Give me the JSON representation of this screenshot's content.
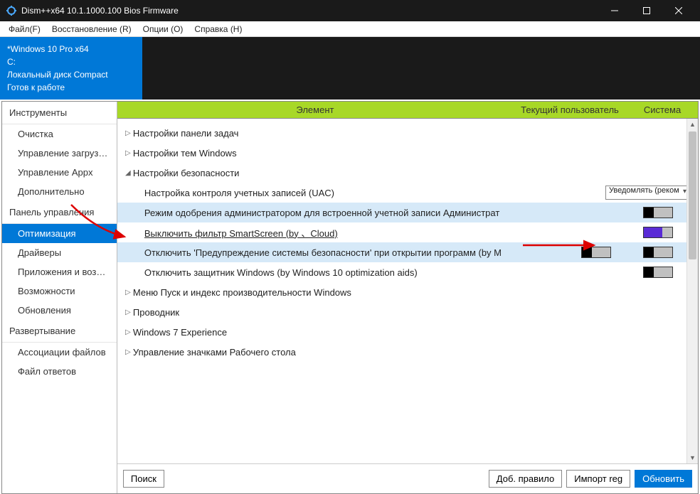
{
  "title": "Dism++x64 10.1.1000.100 Bios Firmware",
  "menu": [
    "Файл(F)",
    "Восстановление (R)",
    "Опции (O)",
    "Справка (H)"
  ],
  "info": {
    "os": "*Windows 10 Pro x64",
    "drive": "C:",
    "disk": "Локальный диск Compact",
    "status": "Готов к работе"
  },
  "sidebar": {
    "groups": [
      {
        "title": "Инструменты",
        "items": [
          "Очистка",
          "Управление загрузкой",
          "Управление Appx",
          "Дополнительно"
        ]
      },
      {
        "title": "Панель управления",
        "items": [
          "Оптимизация",
          "Драйверы",
          "Приложения и возможнос",
          "Возможности",
          "Обновления"
        ]
      },
      {
        "title": "Развертывание",
        "items": [
          "Ассоциации файлов",
          "Файл ответов"
        ]
      }
    ],
    "activeGroup": 1,
    "activeItem": 0
  },
  "columns": {
    "c1": "Элемент",
    "c2": "Текущий пользователь",
    "c3": "Система"
  },
  "rows": [
    {
      "lev": 0,
      "expand": "collapsed",
      "label": "Настройки панели задач"
    },
    {
      "lev": 0,
      "expand": "collapsed",
      "label": "Настройки тем Windows"
    },
    {
      "lev": 0,
      "expand": "expanded",
      "label": "Настройки безопасности"
    },
    {
      "lev": 1,
      "label": "Настройка контроля учетных записей (UAC)",
      "sys": {
        "type": "dropdown",
        "value": "Уведомлять (реком"
      }
    },
    {
      "lev": 1,
      "alt": true,
      "label": "Режим одобрения администратором для встроенной учетной записи Администрат",
      "sys": {
        "type": "toggle",
        "on": false
      }
    },
    {
      "lev": 1,
      "under": true,
      "label": "Выключить фильтр SmartScreen (by 、Cloud)",
      "sys": {
        "type": "toggle",
        "on": true
      }
    },
    {
      "lev": 1,
      "alt": true,
      "label": "Отключить 'Предупреждение системы безопасности' при открытии программ (by М",
      "user": {
        "type": "toggle",
        "on": false
      },
      "sys": {
        "type": "toggle",
        "on": false
      }
    },
    {
      "lev": 1,
      "label": "Отключить защитник Windows (by Windows 10 optimization aids)",
      "sys": {
        "type": "toggle",
        "on": false
      }
    },
    {
      "lev": 0,
      "expand": "collapsed",
      "label": "Меню Пуск и индекс производительности Windows"
    },
    {
      "lev": 0,
      "expand": "collapsed",
      "label": "Проводник"
    },
    {
      "lev": 0,
      "expand": "collapsed",
      "label": "Windows 7 Experience"
    },
    {
      "lev": 0,
      "expand": "collapsed",
      "label": "Управление значками Рабочего стола"
    }
  ],
  "footer": {
    "search": "Поиск",
    "addRule": "Доб. правило",
    "importReg": "Импорт reg",
    "refresh": "Обновить"
  }
}
